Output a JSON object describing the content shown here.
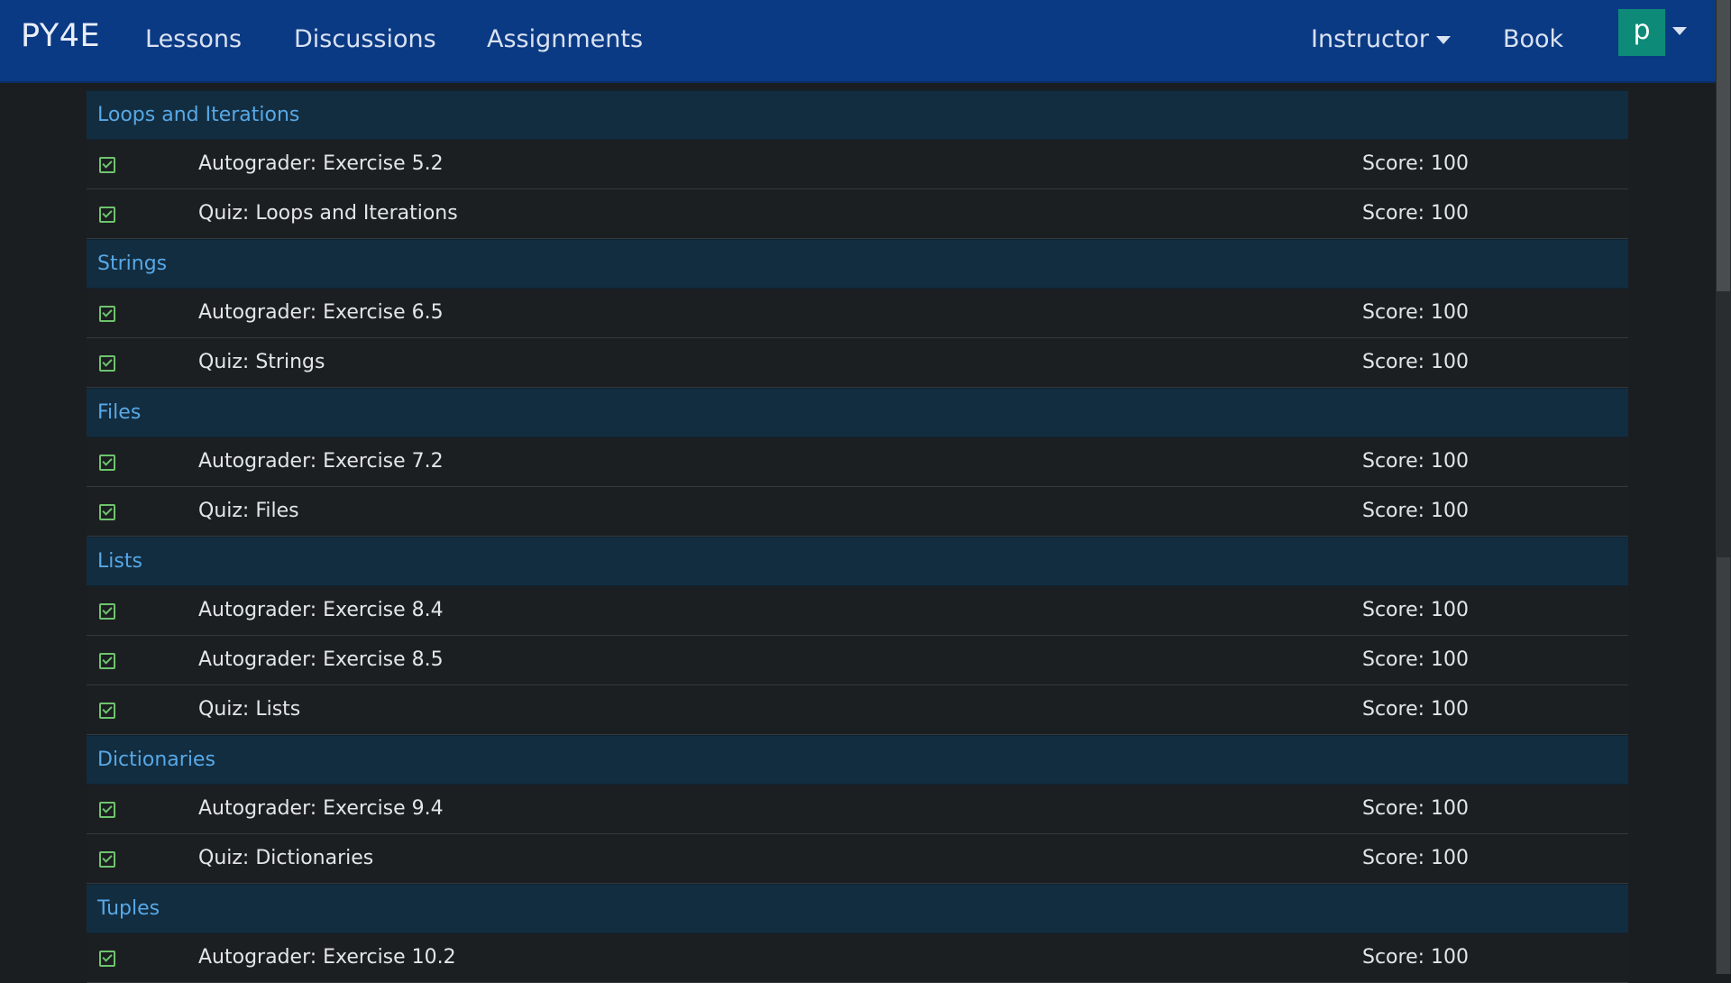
{
  "navbar": {
    "brand": "PY4E",
    "links": [
      "Lessons",
      "Discussions",
      "Assignments"
    ],
    "instructor": "Instructor",
    "book": "Book",
    "avatar_letter": "p"
  },
  "sections": [
    {
      "title": "Loops and Iterations",
      "items": [
        {
          "title": "Autograder: Exercise 5.2",
          "score": "Score: 100"
        },
        {
          "title": "Quiz: Loops and Iterations",
          "score": "Score: 100"
        }
      ]
    },
    {
      "title": "Strings",
      "items": [
        {
          "title": "Autograder: Exercise 6.5",
          "score": "Score: 100"
        },
        {
          "title": "Quiz: Strings",
          "score": "Score: 100"
        }
      ]
    },
    {
      "title": "Files",
      "items": [
        {
          "title": "Autograder: Exercise 7.2",
          "score": "Score: 100"
        },
        {
          "title": "Quiz: Files",
          "score": "Score: 100"
        }
      ]
    },
    {
      "title": "Lists",
      "items": [
        {
          "title": "Autograder: Exercise 8.4",
          "score": "Score: 100"
        },
        {
          "title": "Autograder: Exercise 8.5",
          "score": "Score: 100"
        },
        {
          "title": "Quiz: Lists",
          "score": "Score: 100"
        }
      ]
    },
    {
      "title": "Dictionaries",
      "items": [
        {
          "title": "Autograder: Exercise 9.4",
          "score": "Score: 100"
        },
        {
          "title": "Quiz: Dictionaries",
          "score": "Score: 100"
        }
      ]
    },
    {
      "title": "Tuples",
      "items": [
        {
          "title": "Autograder: Exercise 10.2",
          "score": "Score: 100"
        }
      ]
    }
  ],
  "colors": {
    "navbar": "#0b3a84",
    "section_header_bg": "#132d40",
    "section_header_text": "#57a8e6",
    "check": "#6ec46e",
    "avatar": "#0e8a78"
  },
  "icons": {
    "item_status": "checkbox-checked-icon",
    "dropdown": "caret-down-icon"
  }
}
